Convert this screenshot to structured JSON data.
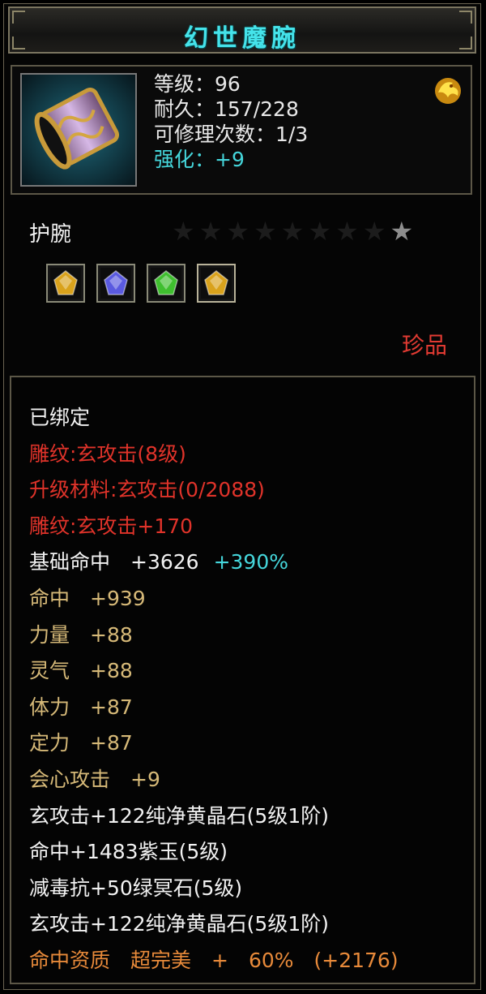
{
  "title": "幻世魔腕",
  "item": {
    "icon": "bracer-icon",
    "level": "等级：96",
    "durability": "耐久：157/228",
    "repairs": "可修理次数：1/3",
    "enhance": "强化：+9",
    "badge_icon": "gold-dragon-badge-icon"
  },
  "category": "护腕",
  "stars": {
    "total": 9,
    "lit": 1
  },
  "gems": [
    {
      "icon": "yellow-crystal-gem-icon",
      "color": "#d9a21c"
    },
    {
      "icon": "purple-jade-gem-icon",
      "color": "#5a5ae0"
    },
    {
      "icon": "green-stone-gem-icon",
      "color": "#3fbf2f"
    },
    {
      "icon": "yellow-crystal-gem-icon",
      "color": "#d9a21c"
    }
  ],
  "rarity": "珍品",
  "properties": [
    {
      "text": "已绑定",
      "color": "white"
    },
    {
      "text": "雕纹:玄攻击(8级)",
      "color": "red"
    },
    {
      "text": "升级材料:玄攻击(0/2088)",
      "color": "red"
    },
    {
      "text": "雕纹:玄攻击+170",
      "color": "red"
    },
    {
      "text": "基础命中  +3626",
      "color": "white",
      "extra": "+390%",
      "extra_color": "cyan"
    },
    {
      "text": "命中  +939",
      "color": "gold"
    },
    {
      "text": "力量  +88",
      "color": "gold"
    },
    {
      "text": "灵气  +88",
      "color": "gold"
    },
    {
      "text": "体力  +87",
      "color": "gold"
    },
    {
      "text": "定力  +87",
      "color": "gold"
    },
    {
      "text": "会心攻击  +9",
      "color": "gold"
    },
    {
      "text": "玄攻击+122纯净黄晶石(5级1阶)",
      "color": "white"
    },
    {
      "text": "命中+1483紫玉(5级)",
      "color": "white"
    },
    {
      "text": "减毒抗+50绿冥石(5级)",
      "color": "white"
    },
    {
      "text": "玄攻击+122纯净黄晶石(5级1阶)",
      "color": "white"
    },
    {
      "text": "命中资质  超完美  +  60%  (+2176)",
      "color": "orange"
    }
  ],
  "colors": {
    "title": "#45e3ea",
    "red": "#e0332a",
    "gold": "#d6b978",
    "orange": "#e88a3a",
    "cyan": "#45d6db"
  }
}
